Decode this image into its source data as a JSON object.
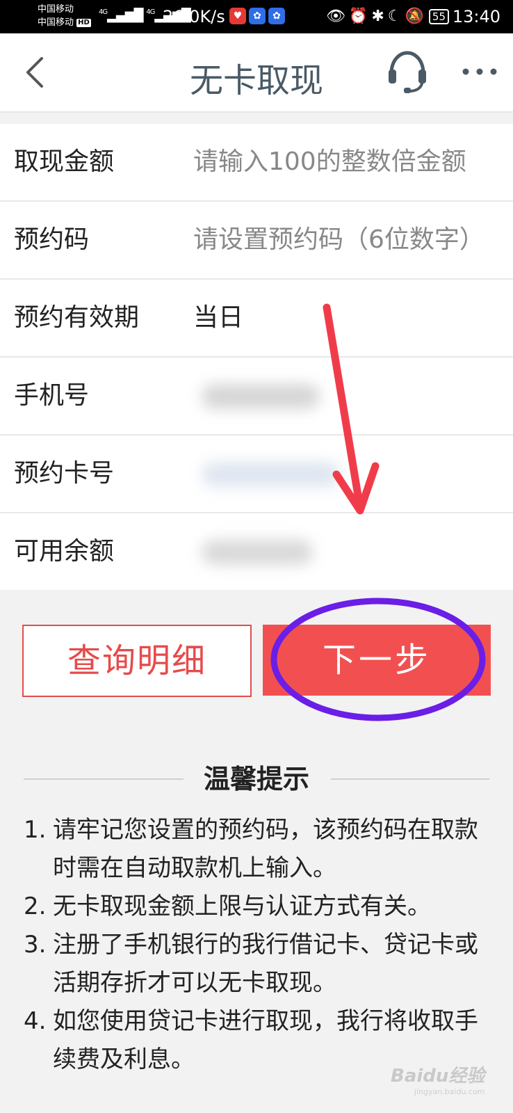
{
  "status_bar": {
    "carrier1": "中国移动",
    "carrier2": "中国移动",
    "hd": "HD",
    "network": "4G",
    "speed": "26.0K/s",
    "battery": "55",
    "time": "13:40"
  },
  "nav": {
    "title": "无卡取现",
    "back_icon": "chevron-left-icon",
    "service_icon": "headset-icon",
    "more_icon": "more-icon"
  },
  "form": {
    "amount": {
      "label": "取现金额",
      "placeholder": "请输入100的整数倍金额"
    },
    "code": {
      "label": "预约码",
      "placeholder": "请设置预约码（6位数字）"
    },
    "validity": {
      "label": "预约有效期",
      "value": "当日"
    },
    "phone": {
      "label": "手机号"
    },
    "card": {
      "label": "预约卡号"
    },
    "balance": {
      "label": "可用余额"
    }
  },
  "buttons": {
    "query": "查询明细",
    "next": "下一步"
  },
  "tips": {
    "title": "温馨提示",
    "items": [
      {
        "num": "1.",
        "text": "请牢记您设置的预约码，该预约码在取款时需在自动取款机上输入。"
      },
      {
        "num": "2.",
        "text": "无卡取现金额上限与认证方式有关。"
      },
      {
        "num": "3.",
        "text": "注册了手机银行的我行借记卡、贷记卡或活期存折才可以无卡取现。"
      },
      {
        "num": "4.",
        "text": "如您使用贷记卡进行取现，我行将收取手续费及利息。"
      }
    ]
  },
  "colors": {
    "accent_red": "#f25050",
    "annotation_purple": "#6a1ee6",
    "annotation_arrow": "#f03c4a"
  },
  "watermark": {
    "brand": "Baidu经验",
    "url": "jingyan.baidu.com"
  }
}
